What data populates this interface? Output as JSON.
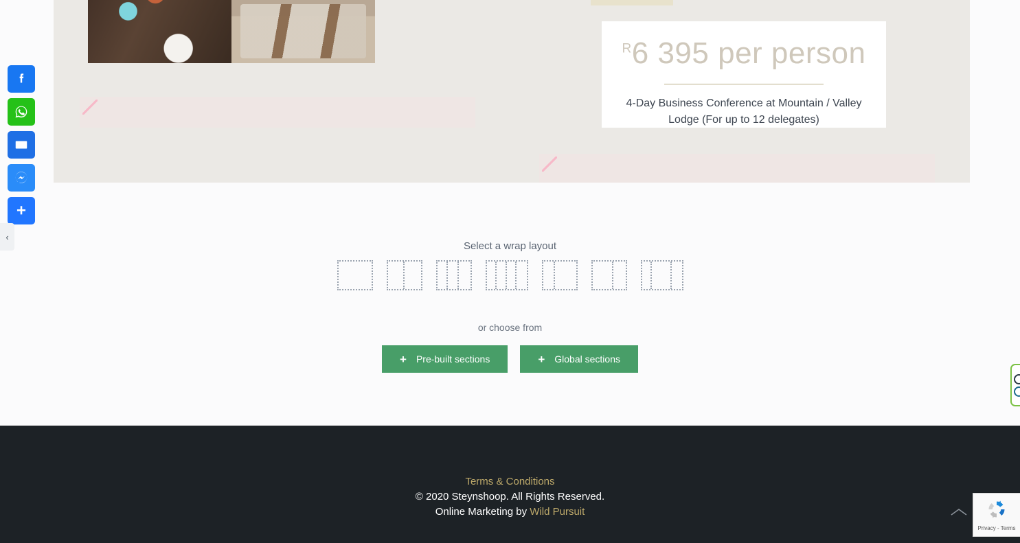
{
  "share_rail": {
    "items": [
      {
        "name": "facebook",
        "label": "Facebook"
      },
      {
        "name": "whatsapp",
        "label": "WhatsApp"
      },
      {
        "name": "email",
        "label": "Email"
      },
      {
        "name": "messenger",
        "label": "Messenger"
      },
      {
        "name": "share",
        "label": "Share"
      }
    ],
    "toggle_glyph": "‹"
  },
  "canvas": {
    "photos": [
      {
        "alt": "People drinking coffee around a table"
      },
      {
        "alt": "Poolside lodge lounge seating"
      }
    ],
    "price_card": {
      "currency": "R",
      "amount": "6 395 per person",
      "description": "4-Day Business Conference at Mountain / Valley Lodge (For up to 12 delegates)"
    }
  },
  "builder": {
    "wrap_label": "Select a wrap layout",
    "layouts": [
      {
        "name": "layout-1-column",
        "widths": [
          100
        ],
        "total_width": 52
      },
      {
        "name": "layout-2-column",
        "widths": [
          50,
          50
        ],
        "total_width": 52
      },
      {
        "name": "layout-3-column",
        "widths": [
          33.33,
          33.33,
          33.34
        ],
        "total_width": 52
      },
      {
        "name": "layout-4-column",
        "widths": [
          25,
          25,
          25,
          25
        ],
        "total_width": 62
      },
      {
        "name": "layout-narrow-wide",
        "widths": [
          36,
          64
        ],
        "total_width": 52
      },
      {
        "name": "layout-wide-narrow",
        "widths": [
          64,
          36
        ],
        "total_width": 52
      },
      {
        "name": "layout-narrow-wide-narrow",
        "widths": [
          25,
          50,
          25
        ],
        "total_width": 62
      }
    ],
    "choose_from": "or choose from",
    "buttons": [
      {
        "name": "pre-built-sections",
        "icon": "plus-icon",
        "glyph": "+",
        "label": "Pre-built sections"
      },
      {
        "name": "global-sections",
        "icon": "plus-icon",
        "glyph": "+",
        "label": "Global sections"
      }
    ],
    "accent_color": "#489e68"
  },
  "footer": {
    "terms_link": "Terms & Conditions",
    "copyright": "© 2020 Steynshoop. All Rights Reserved.",
    "credit_prefix": "Online Marketing by ",
    "credit_link": "Wild Pursuit",
    "link_color": "#bda96a",
    "background": "#1d2226",
    "to_top_glyph": "∧"
  },
  "recaptcha": {
    "terms": "Privacy - Terms",
    "icon": "recaptcha-icon"
  },
  "edge_widget": {
    "icon": "accessibility-widget-icon",
    "border_color": "#7ac143"
  }
}
